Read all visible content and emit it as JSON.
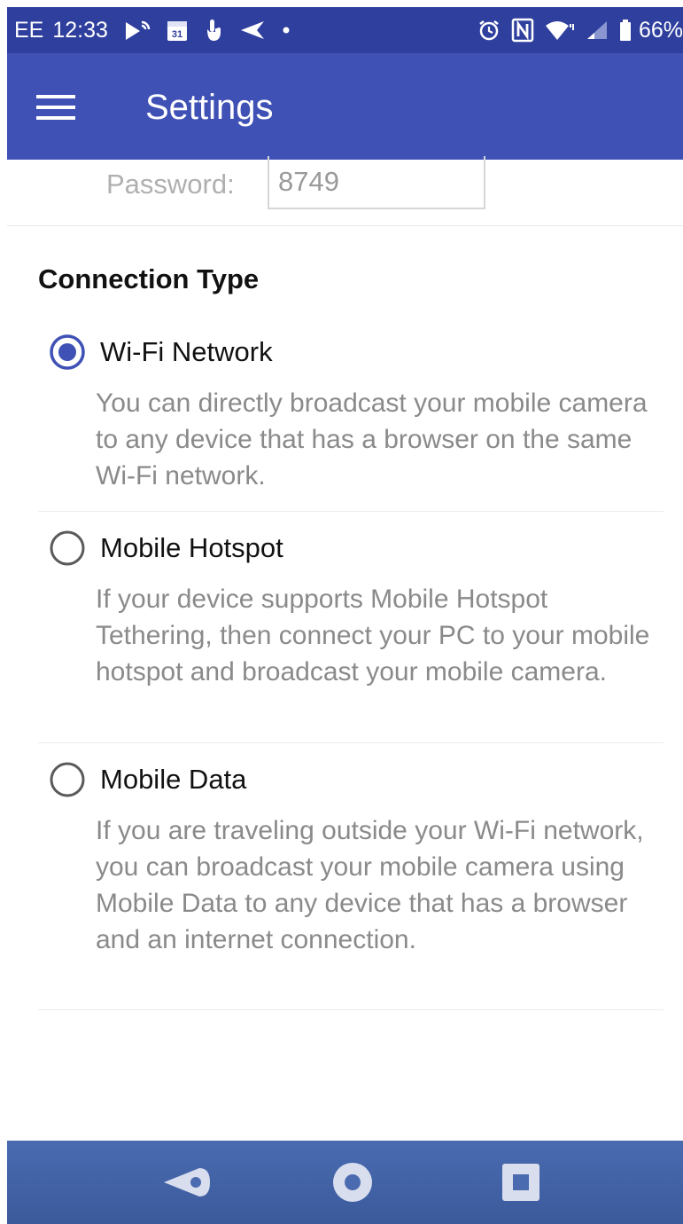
{
  "status_bar": {
    "carrier": "EE",
    "time": "12:33",
    "battery": "66%",
    "left_icons": [
      "cast-icon",
      "calendar-icon",
      "touch-icon",
      "send-icon",
      "dot-icon"
    ],
    "right_icons": [
      "alarm-icon",
      "nfc-icon",
      "wifi-icon",
      "signal-icon",
      "battery-icon"
    ],
    "calendar_day": "31"
  },
  "app_bar": {
    "title": "Settings",
    "menu_icon": "hamburger-menu-icon"
  },
  "password": {
    "label": "Password:",
    "value": "8749"
  },
  "connection_type": {
    "header": "Connection Type",
    "options": [
      {
        "label": "Wi-Fi Network",
        "selected": true,
        "description": "You can directly broadcast your mobile camera to any device that has a browser on the same Wi-Fi network."
      },
      {
        "label": "Mobile Hotspot",
        "selected": false,
        "description": "If your device supports Mobile Hotspot Tethering, then connect your PC to your mobile hotspot and broadcast your mobile camera."
      },
      {
        "label": "Mobile Data",
        "selected": false,
        "description": "If you are traveling outside your Wi-Fi network, you can broadcast your mobile camera using Mobile Data to any device that has a browser and an internet connection."
      }
    ]
  },
  "nav_bar": {
    "buttons": [
      "back-icon",
      "home-icon",
      "recents-icon"
    ]
  },
  "colors": {
    "status_bar": "#2f3f9e",
    "app_bar": "#3f51b5",
    "radio_selected": "#3f51b5",
    "description_text": "#8a8a8a",
    "nav_bar": "#4a6bb0"
  }
}
